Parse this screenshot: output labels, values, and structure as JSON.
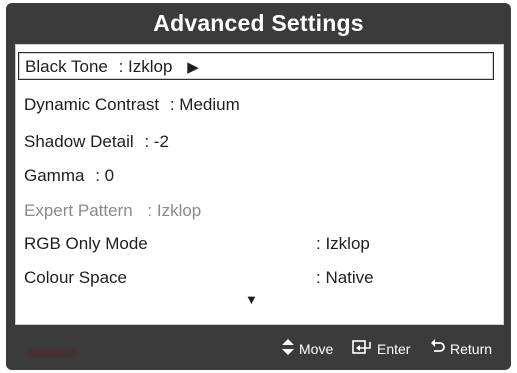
{
  "window": {
    "title": "Advanced Settings"
  },
  "menu": {
    "items": [
      {
        "label": "Black Tone",
        "value": ": Izklop",
        "selected": true,
        "disabled": false
      },
      {
        "label": "Dynamic Contrast",
        "value": ": Medium",
        "selected": false,
        "disabled": false
      },
      {
        "label": "Shadow Detail",
        "value": ": -2",
        "selected": false,
        "disabled": false
      },
      {
        "label": "Gamma",
        "value": ": 0",
        "selected": false,
        "disabled": false
      },
      {
        "label": "Expert Pattern",
        "value": ": Izklop",
        "selected": false,
        "disabled": true
      },
      {
        "label": "RGB Only Mode",
        "value": ": Izklop",
        "selected": false,
        "disabled": false
      },
      {
        "label": "Colour Space",
        "value": ": Native",
        "selected": false,
        "disabled": false
      }
    ],
    "submenu_arrow": "▶",
    "scroll_indicator": "▼"
  },
  "footer": {
    "move_icon": "updown-arrow-icon",
    "move_label": "Move",
    "enter_icon": "enter-icon",
    "enter_label": "Enter",
    "return_icon": "return-icon",
    "return_label": "Return"
  },
  "colors": {
    "panel_bg": "#3b3b3b",
    "menu_bg": "#ffffff",
    "text": "#1e1e1e",
    "disabled_text": "#8a8a8a"
  }
}
